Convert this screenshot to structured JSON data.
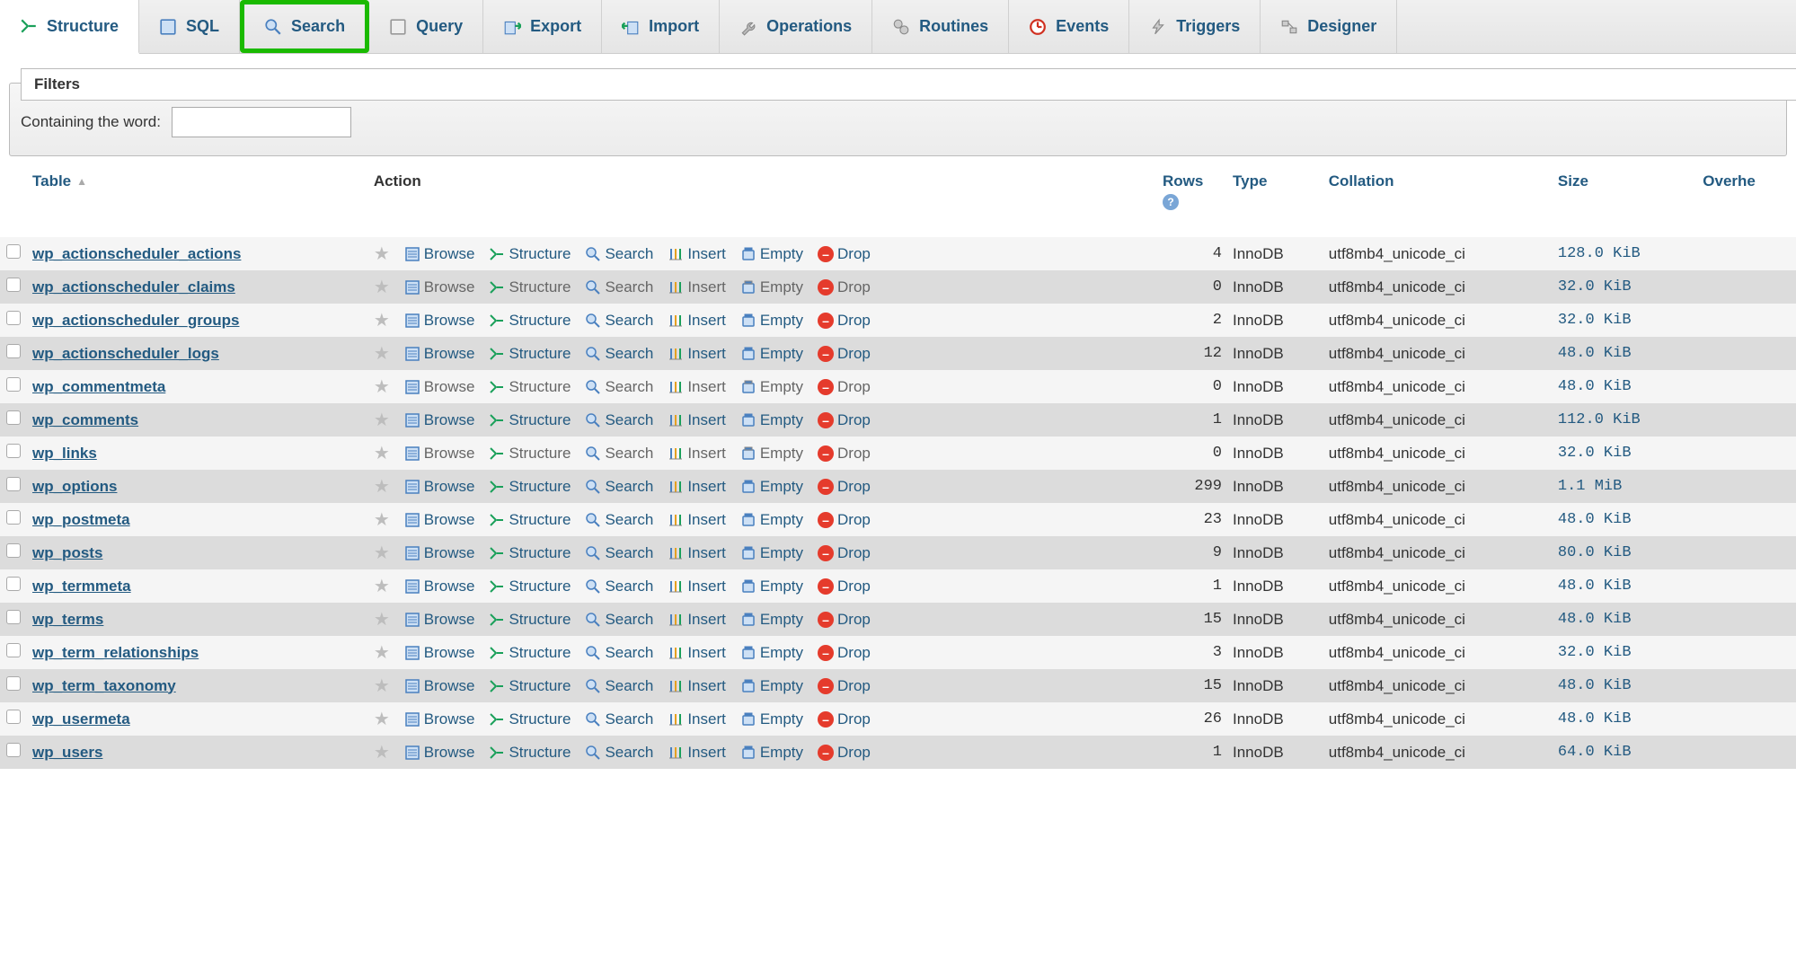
{
  "tabs": [
    {
      "key": "structure",
      "label": "Structure",
      "active": true,
      "highlighted": false
    },
    {
      "key": "sql",
      "label": "SQL"
    },
    {
      "key": "search",
      "label": "Search",
      "highlighted": true
    },
    {
      "key": "query",
      "label": "Query"
    },
    {
      "key": "export",
      "label": "Export"
    },
    {
      "key": "import",
      "label": "Import"
    },
    {
      "key": "operations",
      "label": "Operations"
    },
    {
      "key": "routines",
      "label": "Routines"
    },
    {
      "key": "events",
      "label": "Events"
    },
    {
      "key": "triggers",
      "label": "Triggers"
    },
    {
      "key": "designer",
      "label": "Designer"
    }
  ],
  "filters": {
    "legend": "Filters",
    "label": "Containing the word:",
    "value": ""
  },
  "columns": {
    "table": "Table",
    "action": "Action",
    "rows": "Rows",
    "type": "Type",
    "collation": "Collation",
    "size": "Size",
    "overhead": "Overhe"
  },
  "action_labels": {
    "browse": "Browse",
    "structure": "Structure",
    "search": "Search",
    "insert": "Insert",
    "empty": "Empty",
    "drop": "Drop"
  },
  "tables": [
    {
      "name": "wp_actionscheduler_actions",
      "rows": 4,
      "type": "InnoDB",
      "collation": "utf8mb4_unicode_ci",
      "size": "128.0 KiB",
      "enabled": true
    },
    {
      "name": "wp_actionscheduler_claims",
      "rows": 0,
      "type": "InnoDB",
      "collation": "utf8mb4_unicode_ci",
      "size": "32.0 KiB",
      "enabled": false
    },
    {
      "name": "wp_actionscheduler_groups",
      "rows": 2,
      "type": "InnoDB",
      "collation": "utf8mb4_unicode_ci",
      "size": "32.0 KiB",
      "enabled": true
    },
    {
      "name": "wp_actionscheduler_logs",
      "rows": 12,
      "type": "InnoDB",
      "collation": "utf8mb4_unicode_ci",
      "size": "48.0 KiB",
      "enabled": true
    },
    {
      "name": "wp_commentmeta",
      "rows": 0,
      "type": "InnoDB",
      "collation": "utf8mb4_unicode_ci",
      "size": "48.0 KiB",
      "enabled": false
    },
    {
      "name": "wp_comments",
      "rows": 1,
      "type": "InnoDB",
      "collation": "utf8mb4_unicode_ci",
      "size": "112.0 KiB",
      "enabled": true
    },
    {
      "name": "wp_links",
      "rows": 0,
      "type": "InnoDB",
      "collation": "utf8mb4_unicode_ci",
      "size": "32.0 KiB",
      "enabled": false
    },
    {
      "name": "wp_options",
      "rows": 299,
      "type": "InnoDB",
      "collation": "utf8mb4_unicode_ci",
      "size": "1.1 MiB",
      "enabled": true
    },
    {
      "name": "wp_postmeta",
      "rows": 23,
      "type": "InnoDB",
      "collation": "utf8mb4_unicode_ci",
      "size": "48.0 KiB",
      "enabled": true
    },
    {
      "name": "wp_posts",
      "rows": 9,
      "type": "InnoDB",
      "collation": "utf8mb4_unicode_ci",
      "size": "80.0 KiB",
      "enabled": true
    },
    {
      "name": "wp_termmeta",
      "rows": 1,
      "type": "InnoDB",
      "collation": "utf8mb4_unicode_ci",
      "size": "48.0 KiB",
      "enabled": true
    },
    {
      "name": "wp_terms",
      "rows": 15,
      "type": "InnoDB",
      "collation": "utf8mb4_unicode_ci",
      "size": "48.0 KiB",
      "enabled": true
    },
    {
      "name": "wp_term_relationships",
      "rows": 3,
      "type": "InnoDB",
      "collation": "utf8mb4_unicode_ci",
      "size": "32.0 KiB",
      "enabled": true
    },
    {
      "name": "wp_term_taxonomy",
      "rows": 15,
      "type": "InnoDB",
      "collation": "utf8mb4_unicode_ci",
      "size": "48.0 KiB",
      "enabled": true
    },
    {
      "name": "wp_usermeta",
      "rows": 26,
      "type": "InnoDB",
      "collation": "utf8mb4_unicode_ci",
      "size": "48.0 KiB",
      "enabled": true
    },
    {
      "name": "wp_users",
      "rows": 1,
      "type": "InnoDB",
      "collation": "utf8mb4_unicode_ci",
      "size": "64.0 KiB",
      "enabled": true
    }
  ]
}
